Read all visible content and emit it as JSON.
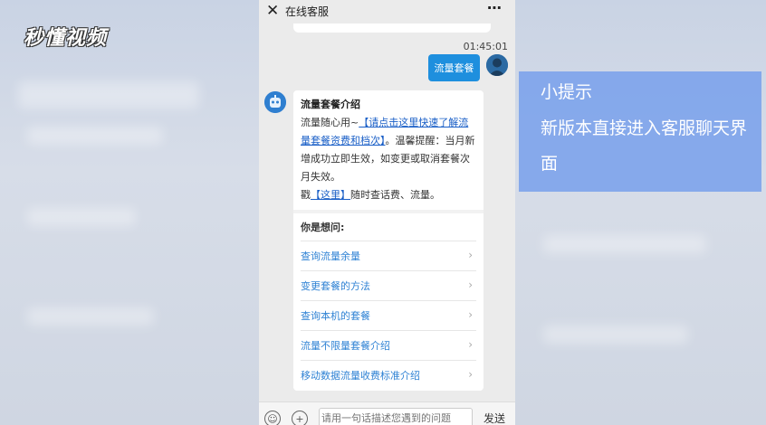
{
  "watermark": "秒懂视频",
  "header": {
    "title": "在线客服",
    "more_icon": "⋯"
  },
  "chat": {
    "timestamp": "01:45:01",
    "user_message": "流量套餐",
    "bot_card": {
      "title": "流量套餐介绍",
      "text_1": "流量随心用~",
      "link_1": "【请点击这里快速了解流量套餐资费和档次】",
      "text_2": "。温馨提醒：当月新增成功立即生效，如变更或取消套餐次月失效。",
      "text_3": "戳",
      "link_2": "【这里】",
      "text_4": "随时查话费、流量。"
    },
    "ask_label": "你是想问:",
    "ask_items": [
      "查询流量余量",
      "变更套餐的方法",
      "查询本机的套餐",
      "流量不限量套餐介绍",
      "移动数据流量收费标准介绍"
    ]
  },
  "input": {
    "placeholder": "请用一句话描述您遇到的问题",
    "send_label": "发送"
  },
  "tip": {
    "title": "小提示",
    "text": "新版本直接进入客服聊天界面"
  },
  "colors": {
    "user_bubble": "#1e8fde",
    "link": "#1a5fc7",
    "ask_item": "#2f82d4",
    "tip_background": "#78a0eb"
  }
}
